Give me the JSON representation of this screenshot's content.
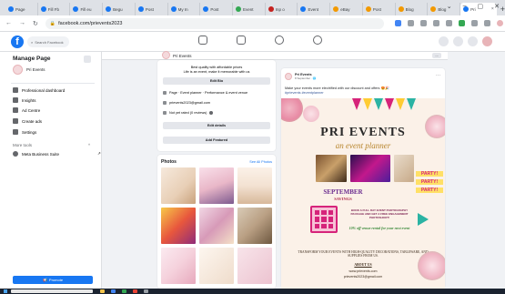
{
  "browser": {
    "tabs": [
      {
        "label": "Page",
        "color": "#1877f2"
      },
      {
        "label": "Fill Fb",
        "color": "#1877f2"
      },
      {
        "label": "Fill eu",
        "color": "#1877f2"
      },
      {
        "label": "Begu",
        "color": "#1877f2"
      },
      {
        "label": "Post",
        "color": "#1877f2"
      },
      {
        "label": "My In",
        "color": "#1877f2"
      },
      {
        "label": "Post",
        "color": "#1877f2"
      },
      {
        "label": "Event",
        "color": "#34a853"
      },
      {
        "label": "Inp o",
        "color": "#c5221f"
      },
      {
        "label": "Event",
        "color": "#1877f2"
      },
      {
        "label": "eBay",
        "color": "#f29900"
      },
      {
        "label": "Post",
        "color": "#f29900"
      },
      {
        "label": "Blog",
        "color": "#f29900"
      },
      {
        "label": "Blog",
        "color": "#f29900"
      },
      {
        "label": "Pri",
        "color": "#1877f2"
      }
    ],
    "window_controls": [
      "⌄",
      "–",
      "▢"
    ],
    "url": "facebook.com/prievents2023"
  },
  "fb": {
    "search_placeholder": "Search Facebook"
  },
  "sidebar": {
    "title": "Manage Page",
    "page_name": "Pri Events",
    "items": [
      {
        "label": "Professional dashboard",
        "icon": "dashboard-icon"
      },
      {
        "label": "Insights",
        "icon": "insights-icon"
      },
      {
        "label": "Ad Centre",
        "icon": "megaphone-icon"
      },
      {
        "label": "Create ads",
        "icon": "pencil-icon"
      },
      {
        "label": "Settings",
        "icon": "gear-icon"
      }
    ],
    "more_tools": "More tools",
    "meta_business": "Meta Business Suite",
    "promote": "Promote"
  },
  "page_header": {
    "name": "Pri Events",
    "more": "..."
  },
  "intro": {
    "bio_line1": "Best quality with affordable prices",
    "bio_line2": "Life is an event, make it memorable with us",
    "edit_bio": "Edit Bio",
    "category": "Page · Event planner · Performance & event venue",
    "email": "prievents2023@gmail.com",
    "rating": "Not yet rated (0 reviews)",
    "edit_details": "Edit details",
    "add_featured": "Add Featured"
  },
  "photos": {
    "title": "Photos",
    "see_all": "See All Photos"
  },
  "post": {
    "name": "Pri Events",
    "time": "8 September · 🌐",
    "text": "Make your events more electrified with our discount and offers 😍🎉",
    "hashtags": "#prievents #eventplanner",
    "poster": {
      "title": "PRI EVENTS",
      "subtitle": "an event planner",
      "september": "SEPTEMBER",
      "savings": "SAVINGS",
      "book": "BOOK A FULL DAY EVENT PHOTOGRAPHY PACKAGE AND GET A FREE ENGAGEMENT PHOTOSHOOT!",
      "off": "10% off venue rental for your next event",
      "party": "PARTY!",
      "transform": "TRANSFORM YOUR EVENTS WITH HIGH-QUALITY DECORATIONS, TABLEWARE, AND SUPPLIES FROM US.",
      "about": "ABOUT US",
      "url": "www.prievents.com",
      "email": "prievents2023@gmail.com"
    }
  },
  "colors": {
    "fb_blue": "#1877f2",
    "poster_bg": "#fbf1e8"
  }
}
